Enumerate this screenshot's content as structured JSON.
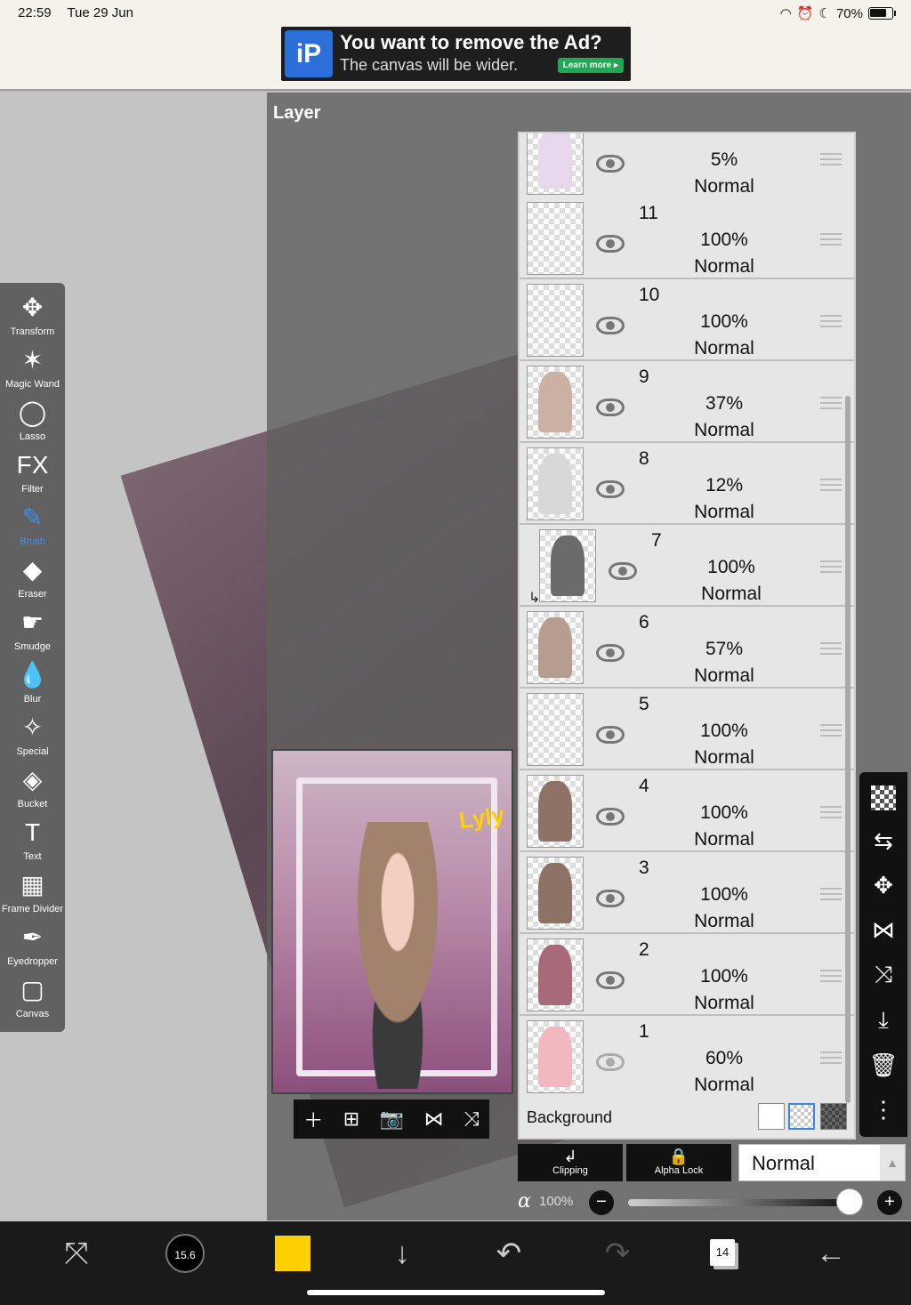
{
  "status": {
    "time": "22:59",
    "date": "Tue 29 Jun",
    "battery": "70%"
  },
  "ad": {
    "title": "You want to remove the Ad?",
    "subtitle": "The canvas will be wider.",
    "button": "Learn more ▸",
    "logo": "iP"
  },
  "panel": {
    "title": "Layer"
  },
  "preview": {
    "tag": "Lyly"
  },
  "layers": [
    {
      "num": "",
      "opacity": "5%",
      "mode": "Normal",
      "visible": true,
      "thumb": "#e8d6ee"
    },
    {
      "num": "11",
      "opacity": "100%",
      "mode": "Normal",
      "visible": true,
      "thumb": ""
    },
    {
      "num": "10",
      "opacity": "100%",
      "mode": "Normal",
      "visible": true,
      "thumb": ""
    },
    {
      "num": "9",
      "opacity": "37%",
      "mode": "Normal",
      "visible": true,
      "thumb": "#cbb1a4"
    },
    {
      "num": "8",
      "opacity": "12%",
      "mode": "Normal",
      "visible": true,
      "thumb": "#d8d8d8"
    },
    {
      "num": "7",
      "opacity": "100%",
      "mode": "Normal",
      "visible": true,
      "thumb": "#6b6b6b",
      "clipped": true
    },
    {
      "num": "6",
      "opacity": "57%",
      "mode": "Normal",
      "visible": true,
      "thumb": "#b79c90"
    },
    {
      "num": "5",
      "opacity": "100%",
      "mode": "Normal",
      "visible": true,
      "thumb": ""
    },
    {
      "num": "4",
      "opacity": "100%",
      "mode": "Normal",
      "visible": true,
      "thumb": "#8f7266"
    },
    {
      "num": "3",
      "opacity": "100%",
      "mode": "Normal",
      "visible": true,
      "thumb": "#8f7266"
    },
    {
      "num": "2",
      "opacity": "100%",
      "mode": "Normal",
      "visible": true,
      "thumb": "#a86a78"
    },
    {
      "num": "1",
      "opacity": "60%",
      "mode": "Normal",
      "visible": false,
      "thumb": "#f2b8c0"
    }
  ],
  "background": {
    "label": "Background"
  },
  "blend": {
    "clipping": "Clipping",
    "alpha_lock": "Alpha Lock",
    "mode": "Normal"
  },
  "alpha": {
    "symbol": "α",
    "value": "100%",
    "level": 1.0
  },
  "tools": [
    {
      "name": "transform",
      "label": "Transform",
      "icon": "✥"
    },
    {
      "name": "magic-wand",
      "label": "Magic Wand",
      "icon": "✶"
    },
    {
      "name": "lasso",
      "label": "Lasso",
      "icon": "◯"
    },
    {
      "name": "filter",
      "label": "Filter",
      "icon": "FX"
    },
    {
      "name": "brush",
      "label": "Brush",
      "icon": "✎",
      "active": true
    },
    {
      "name": "eraser",
      "label": "Eraser",
      "icon": "◆"
    },
    {
      "name": "smudge",
      "label": "Smudge",
      "icon": "☛"
    },
    {
      "name": "blur",
      "label": "Blur",
      "icon": "💧"
    },
    {
      "name": "special",
      "label": "Special",
      "icon": "✧"
    },
    {
      "name": "bucket",
      "label": "Bucket",
      "icon": "◈"
    },
    {
      "name": "text",
      "label": "Text",
      "icon": "T"
    },
    {
      "name": "frame-divider",
      "label": "Frame Divider",
      "icon": "▦"
    },
    {
      "name": "eyedropper",
      "label": "Eyedropper",
      "icon": "✒"
    },
    {
      "name": "canvas",
      "label": "Canvas",
      "icon": "▢"
    }
  ],
  "bottom": {
    "brush_size": "15.6",
    "layer_count": "14",
    "color": "#ffd000"
  },
  "icons": {
    "preview_tools": [
      "＋",
      "⊞",
      "📷",
      "⋈",
      "⤨"
    ],
    "right_tools": [
      "⇆",
      "✥",
      "⋈",
      "⤨",
      "⤓",
      "🗑",
      "⋮"
    ]
  }
}
